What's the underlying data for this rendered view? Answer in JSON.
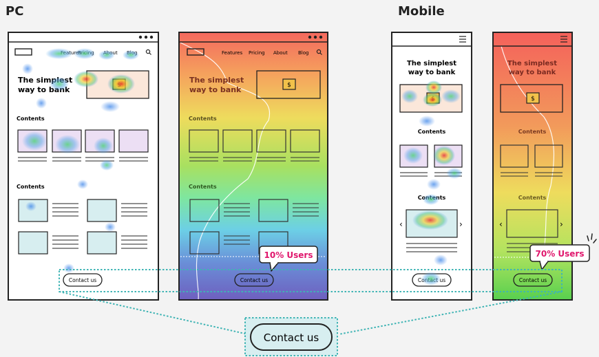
{
  "sections": {
    "pc": "PC",
    "mobile": "Mobile"
  },
  "pc_nav": {
    "features": "Features",
    "pricing": "Pricing",
    "about": "About",
    "blog": "Blog"
  },
  "hero": {
    "line1": "The simplest",
    "line2": "way to bank",
    "dollar": "$"
  },
  "contents_label": "Contents",
  "contact_label": "Contact us",
  "callouts": {
    "pc": "10% Users",
    "mobile": "70% Users"
  },
  "colors": {
    "dotted": "#3fb4b4",
    "callout_text": "#e0176d"
  }
}
